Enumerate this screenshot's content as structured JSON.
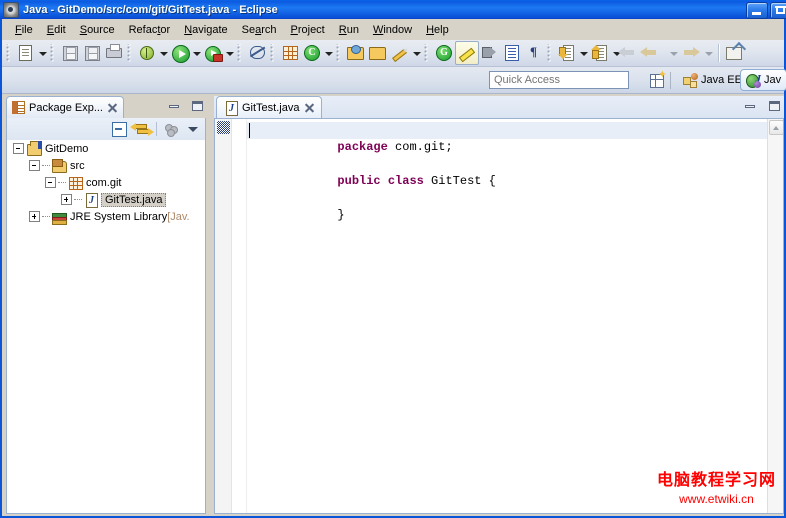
{
  "window": {
    "title": "Java - GitDemo/src/com/git/GitTest.java - Eclipse",
    "app_icon": "eclipse-icon",
    "buttons": [
      {
        "name": "minimize-button",
        "glyph": "minimize-icon"
      },
      {
        "name": "maximize-button",
        "glyph": "maximize-icon"
      }
    ]
  },
  "menubar": {
    "items": [
      {
        "label": "File",
        "mnemonic": "F"
      },
      {
        "label": "Edit",
        "mnemonic": "E"
      },
      {
        "label": "Source",
        "mnemonic": "S"
      },
      {
        "label": "Refactor",
        "mnemonic": "t"
      },
      {
        "label": "Navigate",
        "mnemonic": "N"
      },
      {
        "label": "Search",
        "mnemonic": "a"
      },
      {
        "label": "Project",
        "mnemonic": "P"
      },
      {
        "label": "Run",
        "mnemonic": "R"
      },
      {
        "label": "Window",
        "mnemonic": "W"
      },
      {
        "label": "Help",
        "mnemonic": "H"
      }
    ]
  },
  "toolbar": {
    "items": [
      {
        "name": "new-wizard-button",
        "icon": "new-file-icon",
        "dropdown": true
      },
      {
        "name": "save-button",
        "icon": "save-icon",
        "dropdown": false
      },
      {
        "name": "save-all-button",
        "icon": "save-all-icon",
        "dropdown": false
      },
      {
        "name": "print-button",
        "icon": "print-icon",
        "dropdown": false
      },
      {
        "name": "debug-button",
        "icon": "debug-bug-icon",
        "dropdown": true
      },
      {
        "name": "run-button",
        "icon": "run-play-icon",
        "dropdown": true
      },
      {
        "name": "run-external-tools-button",
        "icon": "run-toolbox-icon",
        "dropdown": true
      },
      {
        "name": "skip-breakpoints-button",
        "icon": "skip-all-breakpoints-icon",
        "dropdown": false
      },
      {
        "name": "new-java-package-button",
        "icon": "new-package-grid-icon",
        "dropdown": false
      },
      {
        "name": "new-java-class-button",
        "icon": "new-class-icon",
        "dropdown": true
      },
      {
        "name": "open-type-button",
        "icon": "open-type-folder-icon",
        "dropdown": false
      },
      {
        "name": "open-task-button",
        "icon": "open-task-folder-icon",
        "dropdown": false
      },
      {
        "name": "edit-pencil-button",
        "icon": "pencil-icon",
        "dropdown": true
      },
      {
        "name": "new-annotation-button",
        "icon": "green-arrow-tag-icon",
        "dropdown": false
      },
      {
        "name": "toggle-mark-occurrences-button",
        "icon": "highlighter-icon",
        "dropdown": false,
        "pressed": true
      },
      {
        "name": "toggle-speaker-button",
        "icon": "speaker-icon",
        "dropdown": false
      },
      {
        "name": "show-whitespace-button",
        "icon": "table-lines-icon",
        "dropdown": false
      },
      {
        "name": "toggle-block-selection-button",
        "icon": "pilcrow-icon",
        "dropdown": false
      },
      {
        "name": "next-annotation-button",
        "icon": "next-annotation-down-arrow-icon",
        "dropdown": true
      },
      {
        "name": "previous-annotation-button",
        "icon": "previous-annotation-up-arrow-icon",
        "dropdown": true
      },
      {
        "name": "last-edit-location-button",
        "icon": "back-curved-arrow-icon",
        "dropdown": false
      },
      {
        "name": "back-button",
        "icon": "back-arrow-icon",
        "dropdown": true
      },
      {
        "name": "forward-button",
        "icon": "forward-arrow-icon",
        "dropdown": true
      },
      {
        "name": "external-tools-button",
        "icon": "external-window-icon",
        "dropdown": false
      }
    ]
  },
  "quick_access": {
    "placeholder": "Quick Access",
    "value": "",
    "new_perspective_label": "",
    "perspectives": [
      {
        "label": "Java EE",
        "icon": "java-ee-perspective-icon",
        "active": false
      },
      {
        "label": "Jav",
        "icon": "java-perspective-icon",
        "active": true
      }
    ]
  },
  "package_explorer": {
    "tab_label": "Package Exp...",
    "tab_icon": "package-explorer-icon",
    "close_label": "",
    "view_buttons": [
      {
        "name": "collapse-all-button",
        "icon": "collapse-all-icon"
      },
      {
        "name": "link-with-editor-button",
        "icon": "link-with-editor-icon"
      },
      {
        "name": "focus-on-active-task-button",
        "icon": "three-dots-icon"
      },
      {
        "name": "view-menu-button",
        "icon": "view-menu-chevron-down-icon"
      }
    ],
    "tree": [
      {
        "label": "GitDemo",
        "icon": "java-project-icon",
        "indent": 0,
        "expander": "minus",
        "selected": false
      },
      {
        "label": "src",
        "icon": "source-folder-icon",
        "indent": 1,
        "expander": "minus",
        "selected": false
      },
      {
        "label": "com.git",
        "icon": "package-icon",
        "indent": 2,
        "expander": "minus",
        "selected": false
      },
      {
        "label": "GitTest.java",
        "icon": "java-file-icon",
        "indent": 3,
        "expander": "plus",
        "selected": true
      },
      {
        "label": "JRE System Library ",
        "suffix": "[Jav.",
        "icon": "jre-library-icon",
        "indent": 1,
        "expander": "plus",
        "selected": false
      }
    ]
  },
  "editor": {
    "tab_label": "GitTest.java",
    "tab_icon": "java-file-icon",
    "close_label": "",
    "lines": [
      {
        "segments": [
          {
            "text": "package",
            "kind": "keyword"
          },
          {
            "text": " com.git;",
            "kind": "plain"
          }
        ],
        "current": true
      },
      {
        "segments": [
          {
            "text": "",
            "kind": "plain"
          }
        ],
        "current": false
      },
      {
        "segments": [
          {
            "text": "public",
            "kind": "keyword"
          },
          {
            "text": " ",
            "kind": "plain"
          },
          {
            "text": "class",
            "kind": "keyword"
          },
          {
            "text": " GitTest {",
            "kind": "plain"
          }
        ],
        "current": false
      },
      {
        "segments": [
          {
            "text": "",
            "kind": "plain"
          }
        ],
        "current": false
      },
      {
        "segments": [
          {
            "text": "}",
            "kind": "plain"
          }
        ],
        "current": false
      }
    ],
    "colors": {
      "keyword": "#7f0055",
      "plain": "#000000",
      "current_line": "#e8eef8"
    }
  },
  "watermark": {
    "line1": "电脑教程学习网",
    "line2": "www.etwiki.cn",
    "color": "#ff0000"
  }
}
